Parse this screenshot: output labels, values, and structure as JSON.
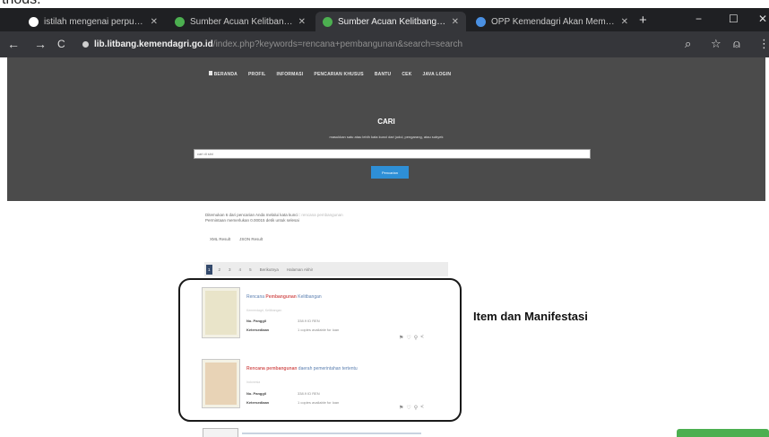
{
  "page_top": {
    "fragment": "thods."
  },
  "browser": {
    "tabs": [
      {
        "title": "istilah mengenai perpustaka...",
        "active": false,
        "icon_color": "#ffffff"
      },
      {
        "title": "Sumber Acuan Kelitbangan | P...",
        "active": false,
        "icon_color": "#4caf50"
      },
      {
        "title": "Sumber Acuan Kelitbangan | P...",
        "active": true,
        "icon_color": "#4caf50"
      },
      {
        "title": "OPP Kemendagri Akan Memu...",
        "active": false,
        "icon_color": "#4a90e2"
      }
    ],
    "new_tab": "+",
    "window": {
      "minimize": "−",
      "maximize": "☐",
      "close": "✕"
    },
    "nav": {
      "back": "←",
      "forward": "→",
      "reload": "C"
    },
    "url_host": "lib.litbang.kemendagri.go.id",
    "url_path": "/index.php?keywords=rencana+pembangunan&search=search",
    "tools": {
      "search": "⌕",
      "star": "☆",
      "profile": "⍝",
      "menu": "⋮"
    }
  },
  "site": {
    "nav_items": [
      "BERANDA",
      "PROFIL",
      "INFORMASI",
      "PENCARIAN KHUSUS",
      "BANTU",
      "CEK",
      "JAVA LOGIN"
    ],
    "hero_title": "CARI",
    "hero_subtitle": "masukkan satu atau lebih kata kunci dari judul, pengarang, atau subyek",
    "search_placeholder": "cari di sini",
    "search_button": "Pencarian"
  },
  "results": {
    "info_line1": "Ditemukan 6 dari pencarian Anda melalui kata kunci :",
    "info_line1_muted": "rencana pembangunan",
    "info_line2": "Permintaan memerlukan 0.00015 detik untuk selesai",
    "view_links": [
      "XML Result",
      "JSON Result"
    ],
    "pages": [
      "1",
      "2",
      "3",
      "4",
      "5",
      "Berikutnya",
      "Halaman Akhir"
    ],
    "items": [
      {
        "title_pre": "Rencana ",
        "title_highlight": "Pembangunan",
        "title_post": " Kelitbangan",
        "author": "Kemendagri, Kelitbangan",
        "call_label": "No. Panggil",
        "call_value": "338.9 ID REN",
        "avail_label": "Ketersediaan",
        "avail_value": "1 copies available for loan",
        "actions": [
          "⚑",
          "♡",
          "⚲",
          "<"
        ]
      },
      {
        "title_pre": "",
        "title_highlight": "Rencana pembangunan",
        "title_post": " daerah pemerintahan tertentu",
        "author": "Indonesia",
        "call_label": "No. Panggil",
        "call_value": "338.9 ID REN",
        "avail_label": "Ketersediaan",
        "avail_value": "1 copies available for loan",
        "actions": [
          "⚑",
          "♡",
          "⚲",
          "<"
        ]
      }
    ]
  },
  "annotation": "Item dan Manifestasi",
  "colors": {
    "tab_bar": "#1f2023",
    "toolbar": "#35363a",
    "hero_bg": "#4b4b4b",
    "search_button": "#2e8fd6",
    "link": "#5b7fb0",
    "keyword_highlight": "#d45a5a",
    "chat_button": "#4caf50"
  }
}
